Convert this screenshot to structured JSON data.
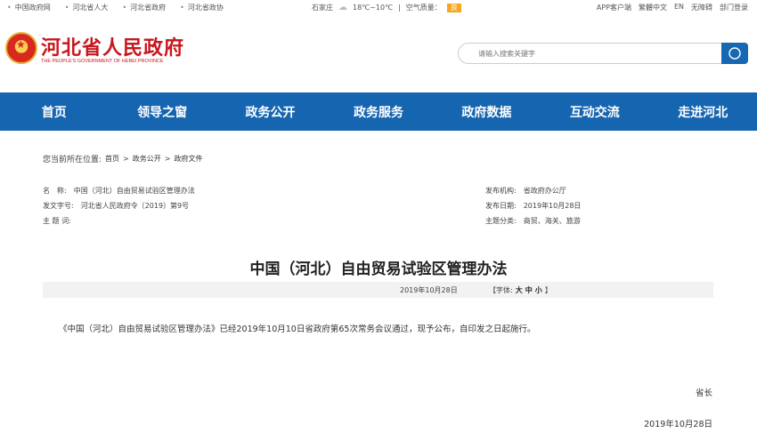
{
  "topbar": {
    "links": [
      "中国政府网",
      "河北省人大",
      "河北省政府",
      "河北省政协"
    ],
    "weather": {
      "city": "石家庄",
      "temp": "18℃~10℃",
      "sep": "|",
      "aq_label": "空气质量：",
      "aq_value": "良"
    },
    "right_links": [
      "APP客户端",
      "繁體中文",
      "EN",
      "无障碍",
      "部门登录"
    ]
  },
  "header": {
    "title": "河北省人民政府",
    "subtitle": "THE PEOPLE'S GOVERNMENT OF HEBEI PROVINCE",
    "search_placeholder": "请输入搜索关键字"
  },
  "nav": [
    "首页",
    "领导之窗",
    "政务公开",
    "政务服务",
    "政府数据",
    "互动交流",
    "走进河北"
  ],
  "breadcrumb": {
    "label": "您当前所在位置:",
    "items": [
      "首页",
      "政务公开",
      "政府文件"
    ],
    "sep": ">"
  },
  "meta": {
    "name_label": "名　称:",
    "name_value": "中国（河北）自由贸易试验区管理办法",
    "doc_no_label": "发文字号:",
    "doc_no_value": "河北省人民政府令〔2019〕第9号",
    "keywords_label": "主 题 词:",
    "keywords_value": "",
    "publisher_label": "发布机构:",
    "publisher_value": "省政府办公厅",
    "pub_date_label": "发布日期:",
    "pub_date_value": "2019年10月28日",
    "category_label": "主题分类:",
    "category_value": "商贸、海关、旅游"
  },
  "article": {
    "title": "中国（河北）自由贸易试验区管理办法",
    "date": "2019年10月28日",
    "font_label": "【字体:",
    "font_large": "大",
    "font_medium": "中",
    "font_small": "小",
    "font_close": "】",
    "body": "《中国（河北）自由贸易试验区管理办法》已经2019年10月10日省政府第65次常务会议通过，现予公布，自印发之日起施行。",
    "signer": "省长",
    "sign_date": "2019年10月28日"
  }
}
